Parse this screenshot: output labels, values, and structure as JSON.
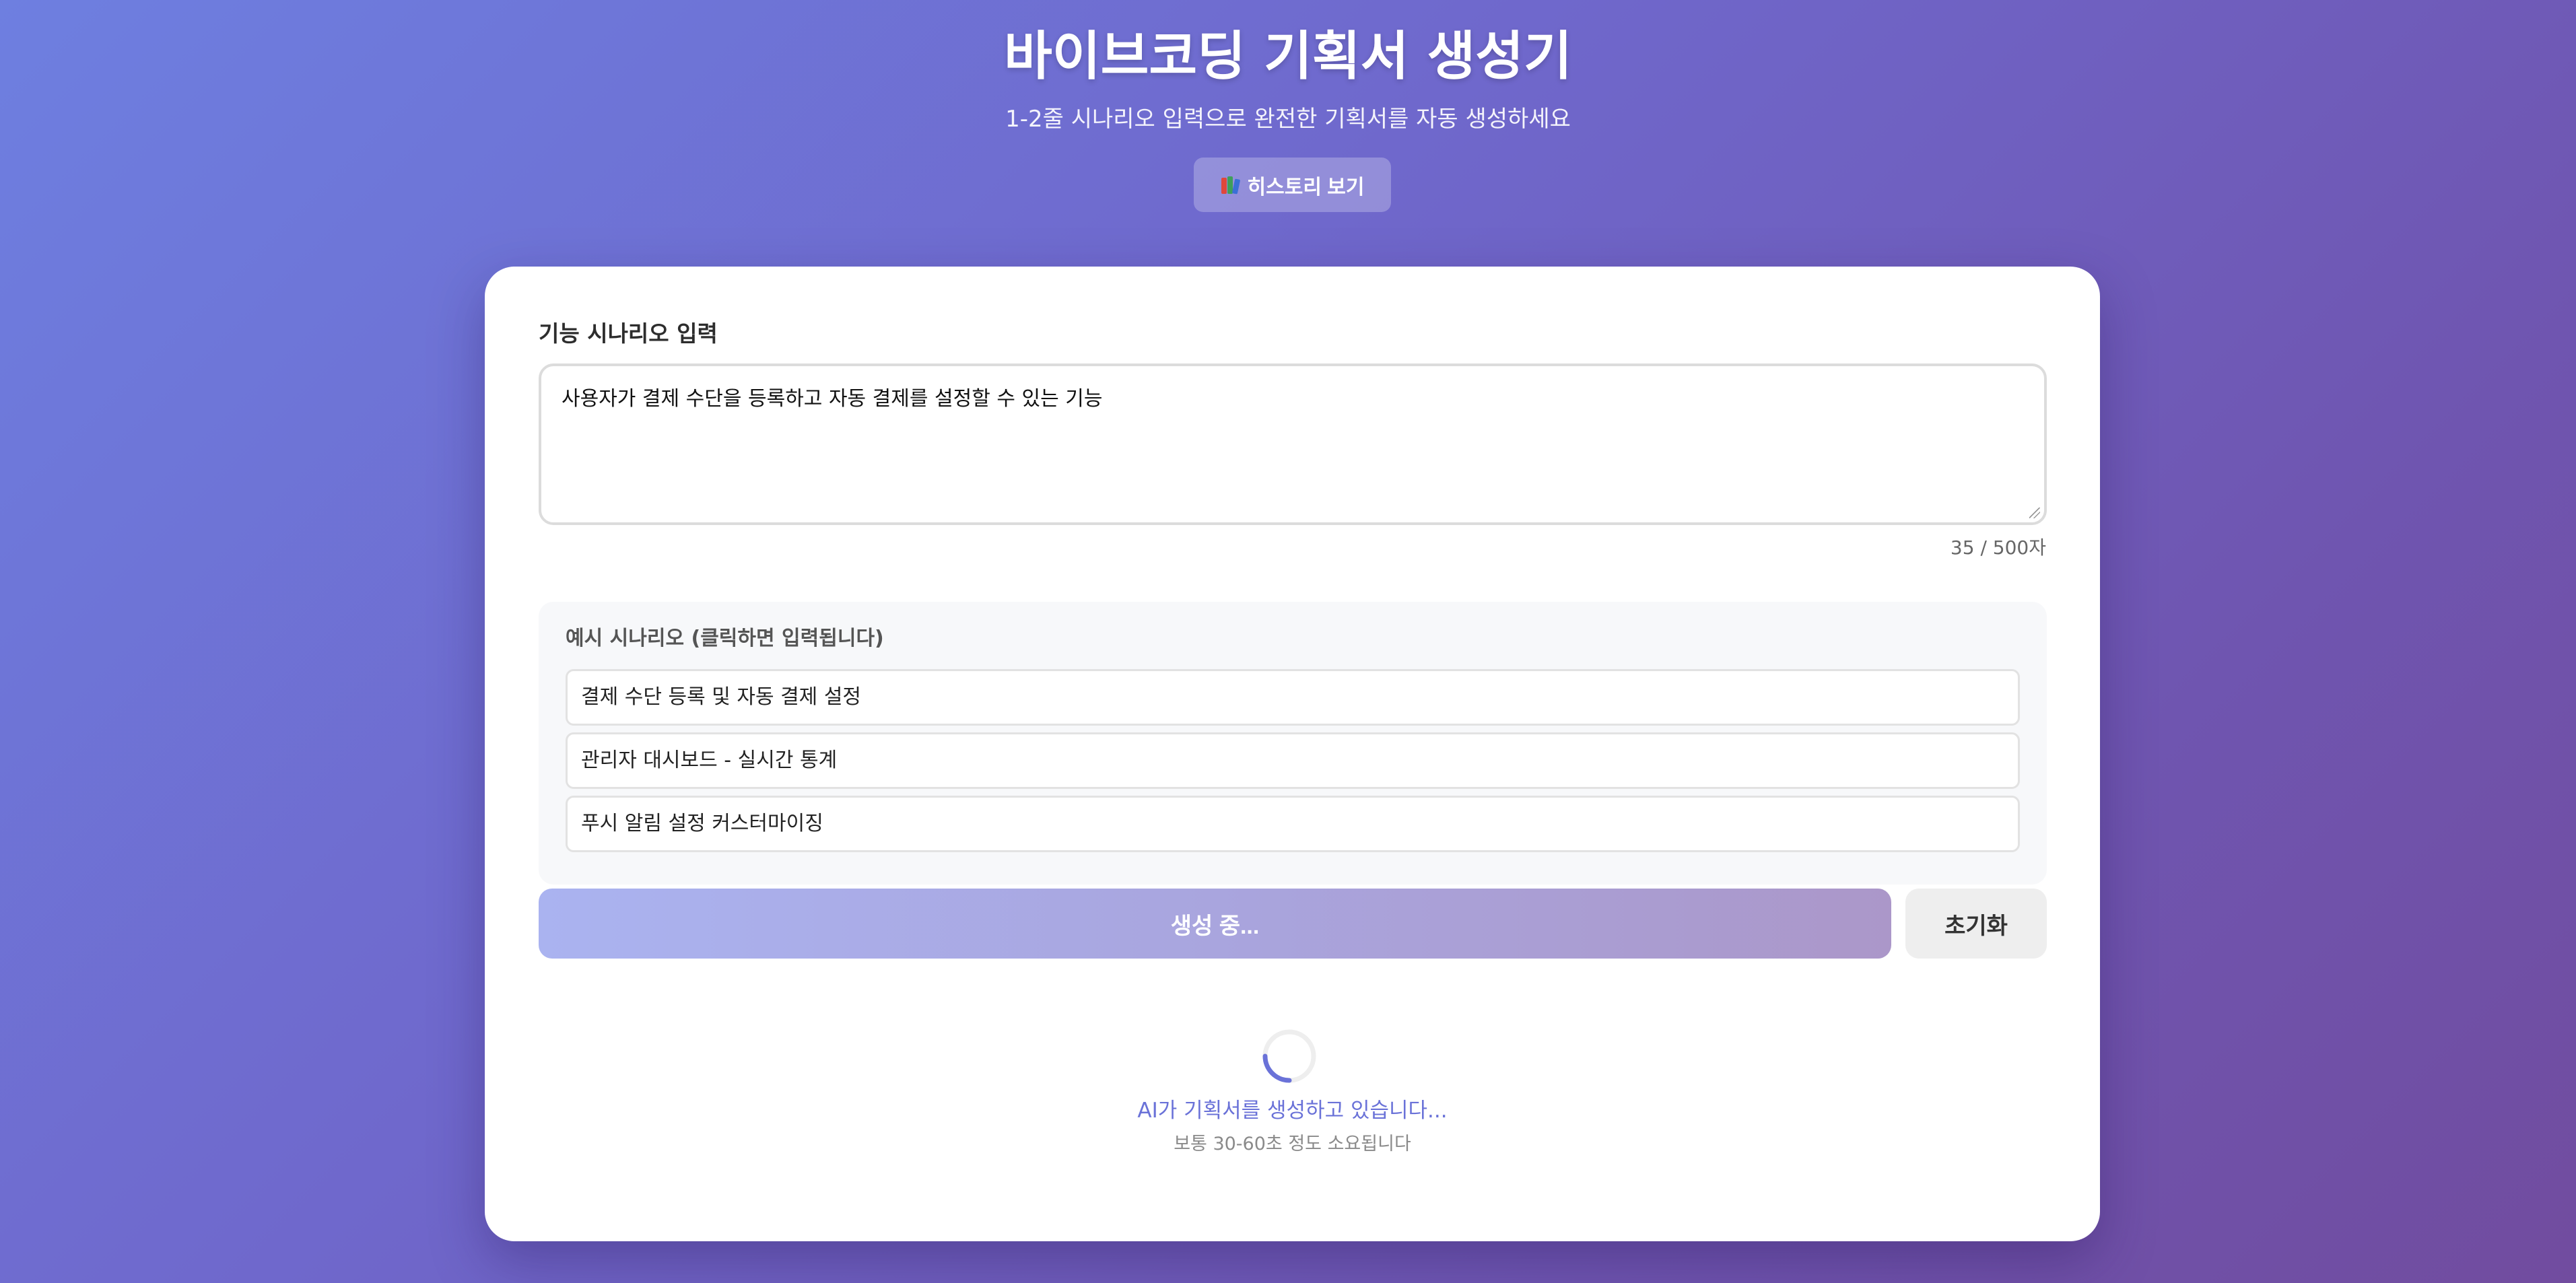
{
  "header": {
    "title": "바이브코딩 기획서 생성기",
    "subtitle": "1-2줄 시나리오 입력으로 완전한 기획서를 자동 생성하세요",
    "history_button": "히스토리 보기",
    "history_icon": "books-icon"
  },
  "form": {
    "scenario_label": "기능 시나리오 입력",
    "scenario_value": "사용자가 결제 수단을 등록하고 자동 결제를 설정할 수 있는 기능",
    "char_counter": "35 / 500자"
  },
  "examples": {
    "title": "예시 시나리오 (클릭하면 입력됩니다)",
    "items": [
      "결제 수단 등록 및 자동 결제 설정",
      "관리자 대시보드 - 실시간 통계",
      "푸시 알림 설정 커스터마이징"
    ]
  },
  "actions": {
    "generate_button": "생성 중...",
    "reset_button": "초기화"
  },
  "loading": {
    "message": "AI가 기획서를 생성하고 있습니다...",
    "sub_message": "보통 30-60초 정도 소요됩니다",
    "icon": "spinner-icon"
  },
  "colors": {
    "accent": "#6a72d8",
    "background_start": "#6e7fe0",
    "background_end": "#714c9f"
  }
}
